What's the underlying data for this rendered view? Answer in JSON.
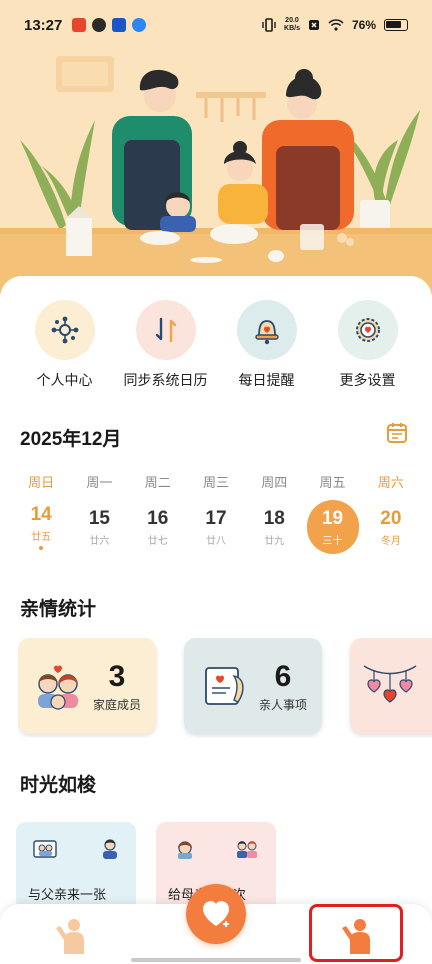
{
  "status_bar": {
    "time": "13:27",
    "network_speed_value": "20.0",
    "network_speed_unit": "KB/s",
    "battery": "76%"
  },
  "features": [
    {
      "label": "个人中心",
      "icon": "network-icon"
    },
    {
      "label": "同步系统日历",
      "icon": "sync-icon"
    },
    {
      "label": "每日提醒",
      "icon": "bell-icon"
    },
    {
      "label": "更多设置",
      "icon": "settings-gear-icon"
    }
  ],
  "calendar": {
    "title": "2025年12月",
    "days": [
      {
        "weekday": "周日",
        "date": "14",
        "lunar": "廿五",
        "weekend": true,
        "today": true,
        "selected": false
      },
      {
        "weekday": "周一",
        "date": "15",
        "lunar": "廿六",
        "weekend": false,
        "today": false,
        "selected": false
      },
      {
        "weekday": "周二",
        "date": "16",
        "lunar": "廿七",
        "weekend": false,
        "today": false,
        "selected": false
      },
      {
        "weekday": "周三",
        "date": "17",
        "lunar": "廿八",
        "weekend": false,
        "today": false,
        "selected": false
      },
      {
        "weekday": "周四",
        "date": "18",
        "lunar": "廿九",
        "weekend": false,
        "today": false,
        "selected": false
      },
      {
        "weekday": "周五",
        "date": "19",
        "lunar": "三十",
        "weekend": false,
        "today": false,
        "selected": true
      },
      {
        "weekday": "周六",
        "date": "20",
        "lunar": "冬月",
        "weekend": true,
        "today": false,
        "selected": false
      }
    ]
  },
  "stats": {
    "title": "亲情统计",
    "cards": [
      {
        "value": "3",
        "label": "家庭成员",
        "bg": "#fbeed3"
      },
      {
        "value": "6",
        "label": "亲人事项",
        "bg": "#dfe9ea"
      }
    ]
  },
  "time_section": {
    "title": "时光如梭",
    "cards": [
      {
        "text": "与父亲来一张",
        "bg": "#e2f1f5"
      },
      {
        "text": "给母亲洗一次",
        "bg": "#fbe6e3"
      }
    ]
  },
  "colors": {
    "accent": "#f37c3f",
    "weekend": "#e89b3c",
    "selected_date": "#f2a24a",
    "hero_bg": "#fbe3bd",
    "highlight": "#e02020"
  }
}
